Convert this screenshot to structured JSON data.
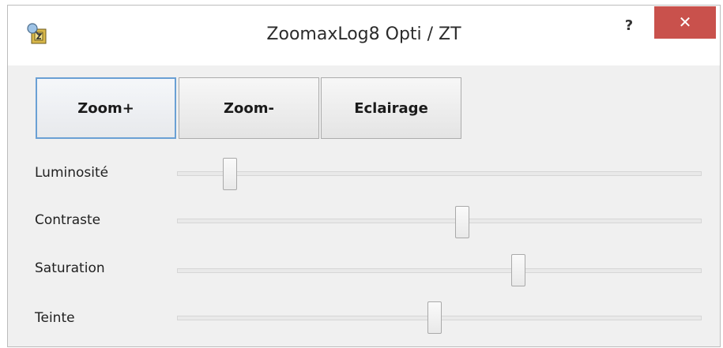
{
  "window": {
    "title": "ZoomaxLog8 Opti / ZT",
    "help_label": "?",
    "close_label": "✕"
  },
  "buttons": [
    {
      "label": "Zoom+",
      "focused": true
    },
    {
      "label": "Zoom-",
      "focused": false
    },
    {
      "label": "Eclairage",
      "focused": false
    }
  ],
  "sliders": [
    {
      "label": "Luminosité",
      "value_fraction": 0.09
    },
    {
      "label": "Contraste",
      "value_fraction": 0.545
    },
    {
      "label": "Saturation",
      "value_fraction": 0.655
    },
    {
      "label": "Teinte",
      "value_fraction": 0.49
    }
  ],
  "colors": {
    "close_button": "#c9514c",
    "focus_border": "#6aa0d4"
  },
  "icons": [
    "app-icon",
    "help-icon",
    "close-icon"
  ]
}
